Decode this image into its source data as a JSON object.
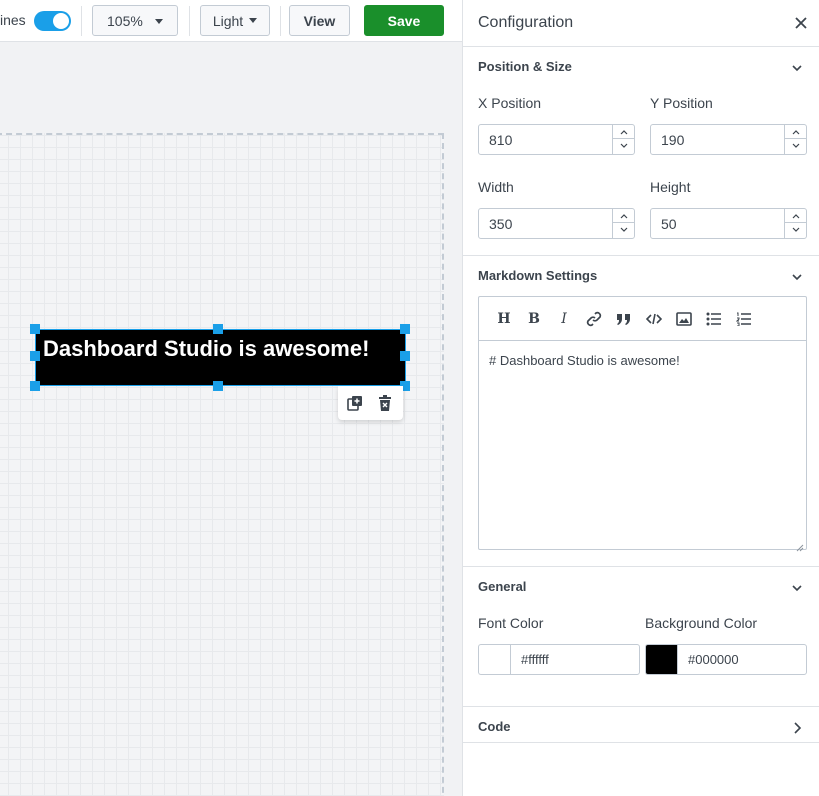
{
  "toolbar": {
    "gridlines_label": "ines",
    "zoom_value": "105%",
    "theme_value": "Light",
    "view_label": "View",
    "save_label": "Save"
  },
  "canvas": {
    "markdown_viz_text": "Dashboard Studio is awesome!"
  },
  "panel": {
    "title": "Configuration",
    "position_size": {
      "title": "Position & Size",
      "x_label": "X Position",
      "x_value": "810",
      "y_label": "Y Position",
      "y_value": "190",
      "width_label": "Width",
      "width_value": "350",
      "height_label": "Height",
      "height_value": "50"
    },
    "markdown": {
      "title": "Markdown Settings",
      "content": "# Dashboard Studio is awesome!"
    },
    "general": {
      "title": "General",
      "font_color_label": "Font Color",
      "font_color_value": "#ffffff",
      "bg_color_label": "Background Color",
      "bg_color_value": "#000000"
    },
    "code": {
      "title": "Code"
    }
  },
  "colors": {
    "accent": "#1a9fe8",
    "save": "#1a8f2b",
    "font_swatch": "#ffffff",
    "bg_swatch": "#000000"
  }
}
